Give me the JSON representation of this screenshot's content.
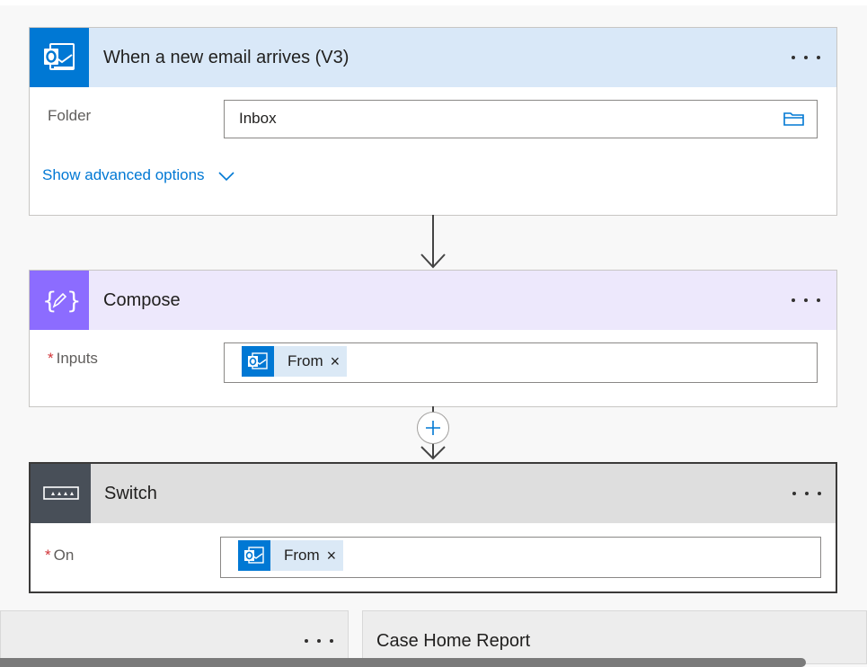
{
  "trigger_card": {
    "title": "When a new email arrives (V3)",
    "icon": "outlook-icon",
    "header_color": "#d9e8f8",
    "icon_color": "#0078d4",
    "folder_label": "Folder",
    "folder_value": "Inbox",
    "advanced_options_label": "Show advanced options"
  },
  "compose_card": {
    "title": "Compose",
    "icon": "compose-icon",
    "header_color": "#ede8fc",
    "icon_color": "#8c6cff",
    "inputs_label": "Inputs",
    "inputs_token": "From"
  },
  "switch_card": {
    "title": "Switch",
    "icon": "switch-icon",
    "header_color": "#dedede",
    "icon_color": "#484f58",
    "on_label": "On",
    "on_token": "From"
  },
  "bottom_right_card": {
    "title": "Case Home Report"
  },
  "required_marker": "*",
  "token_remove_glyph": "×"
}
